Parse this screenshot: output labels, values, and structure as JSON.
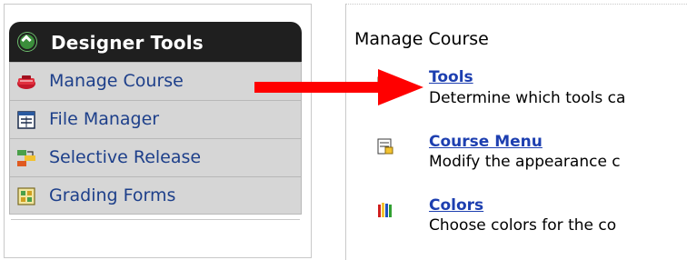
{
  "left_panel": {
    "header_title": "Designer Tools",
    "items": [
      {
        "label": "Manage Course",
        "icon": "manage-course-icon"
      },
      {
        "label": "File Manager",
        "icon": "file-manager-icon"
      },
      {
        "label": "Selective Release",
        "icon": "selective-release-icon"
      },
      {
        "label": "Grading Forms",
        "icon": "grading-forms-icon"
      }
    ]
  },
  "right_panel": {
    "title": "Manage Course",
    "tools": [
      {
        "name": "Tools",
        "description": "Determine which tools ca",
        "icon": "tools-icon"
      },
      {
        "name": "Course Menu",
        "description": "Modify the appearance c",
        "icon": "course-menu-icon"
      },
      {
        "name": "Colors",
        "description": "Choose colors for the co",
        "icon": "colors-icon"
      }
    ]
  },
  "colors": {
    "header_background": "#1f1f1f",
    "menu_background": "#d6d6d6",
    "link_color": "#1d3fb0",
    "arrow_color": "#ff0000"
  }
}
